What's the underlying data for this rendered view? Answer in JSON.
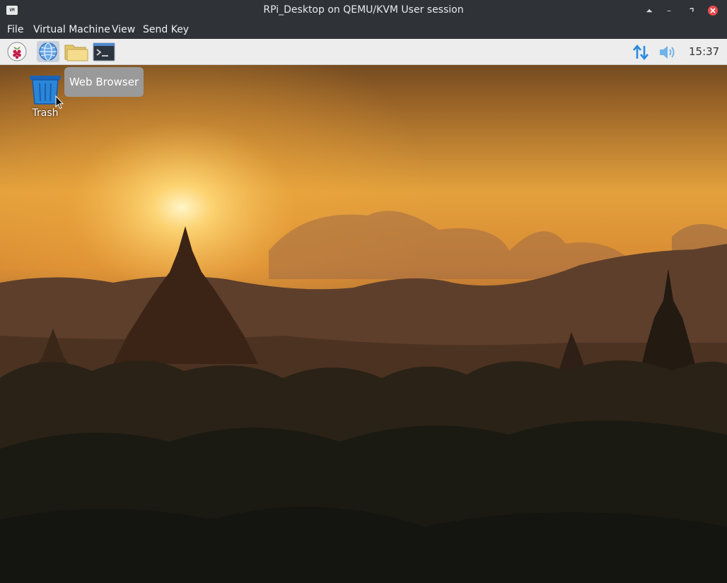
{
  "window": {
    "title": "RPi_Desktop on QEMU/KVM User session",
    "app_icon_text": "VM"
  },
  "menubar": {
    "items": [
      "File",
      "Virtual Machine",
      "View",
      "Send Key"
    ]
  },
  "panel": {
    "launchers": [
      {
        "name": "raspberry-menu",
        "icon": "raspberry-icon"
      },
      {
        "name": "web-browser",
        "icon": "globe-icon"
      },
      {
        "name": "file-manager",
        "icon": "folder-icon"
      },
      {
        "name": "terminal",
        "icon": "terminal-icon"
      }
    ],
    "clock": "15:37",
    "tray": [
      "network-arrows-icon",
      "volume-icon"
    ]
  },
  "desktop": {
    "icons": [
      {
        "label": "Trash",
        "icon": "trash-icon"
      }
    ],
    "tooltip": "Web Browser"
  },
  "colors": {
    "tray_blue": "#2a8be0",
    "close_red": "#ea4b4b",
    "panel_bg": "#ededed"
  }
}
